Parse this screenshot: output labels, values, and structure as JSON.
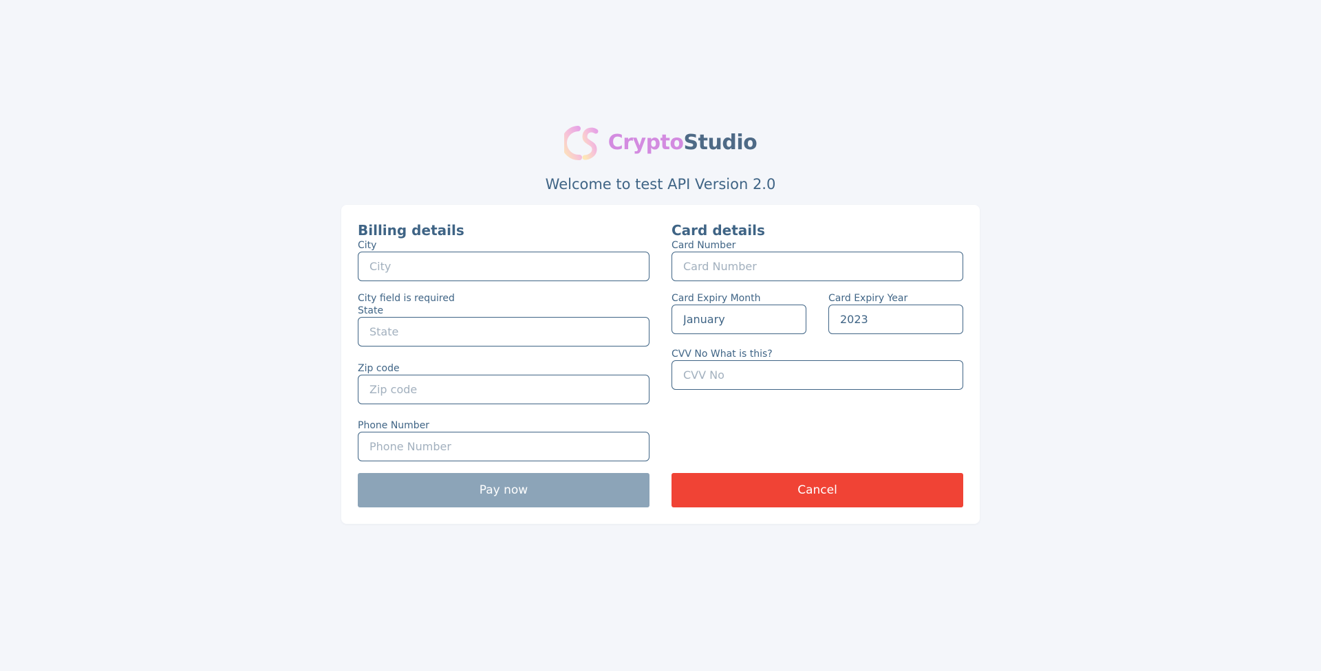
{
  "brand": {
    "name_part1": "Crypto",
    "name_part2": "Studio",
    "logo_icon": "crypto-studio-logo-icon"
  },
  "welcome_text": "Welcome to test API Version 2.0",
  "billing": {
    "title": "Billing details",
    "city": {
      "label": "City",
      "placeholder": "City",
      "value": "",
      "error": "City field is required"
    },
    "state": {
      "label": "State",
      "placeholder": "State",
      "value": ""
    },
    "zip": {
      "label": "Zip code",
      "placeholder": "Zip code",
      "value": ""
    },
    "phone": {
      "label": "Phone Number",
      "placeholder": "Phone Number",
      "value": ""
    }
  },
  "card": {
    "title": "Card details",
    "number": {
      "label": "Card Number",
      "placeholder": "Card Number",
      "value": ""
    },
    "expiry_month": {
      "label": "Card Expiry Month",
      "value": "January"
    },
    "expiry_year": {
      "label": "Card Expiry Year",
      "value": "2023"
    },
    "cvv": {
      "label": "CVV No What is this?",
      "placeholder": "CVV No",
      "value": ""
    }
  },
  "actions": {
    "pay_label": "Pay now",
    "cancel_label": "Cancel"
  },
  "colors": {
    "page_background": "#f4f6fa",
    "text_primary": "#3f6485",
    "pay_button": "#8ca4b8",
    "cancel_button": "#f04335",
    "brand_pink": "#d38be0"
  }
}
